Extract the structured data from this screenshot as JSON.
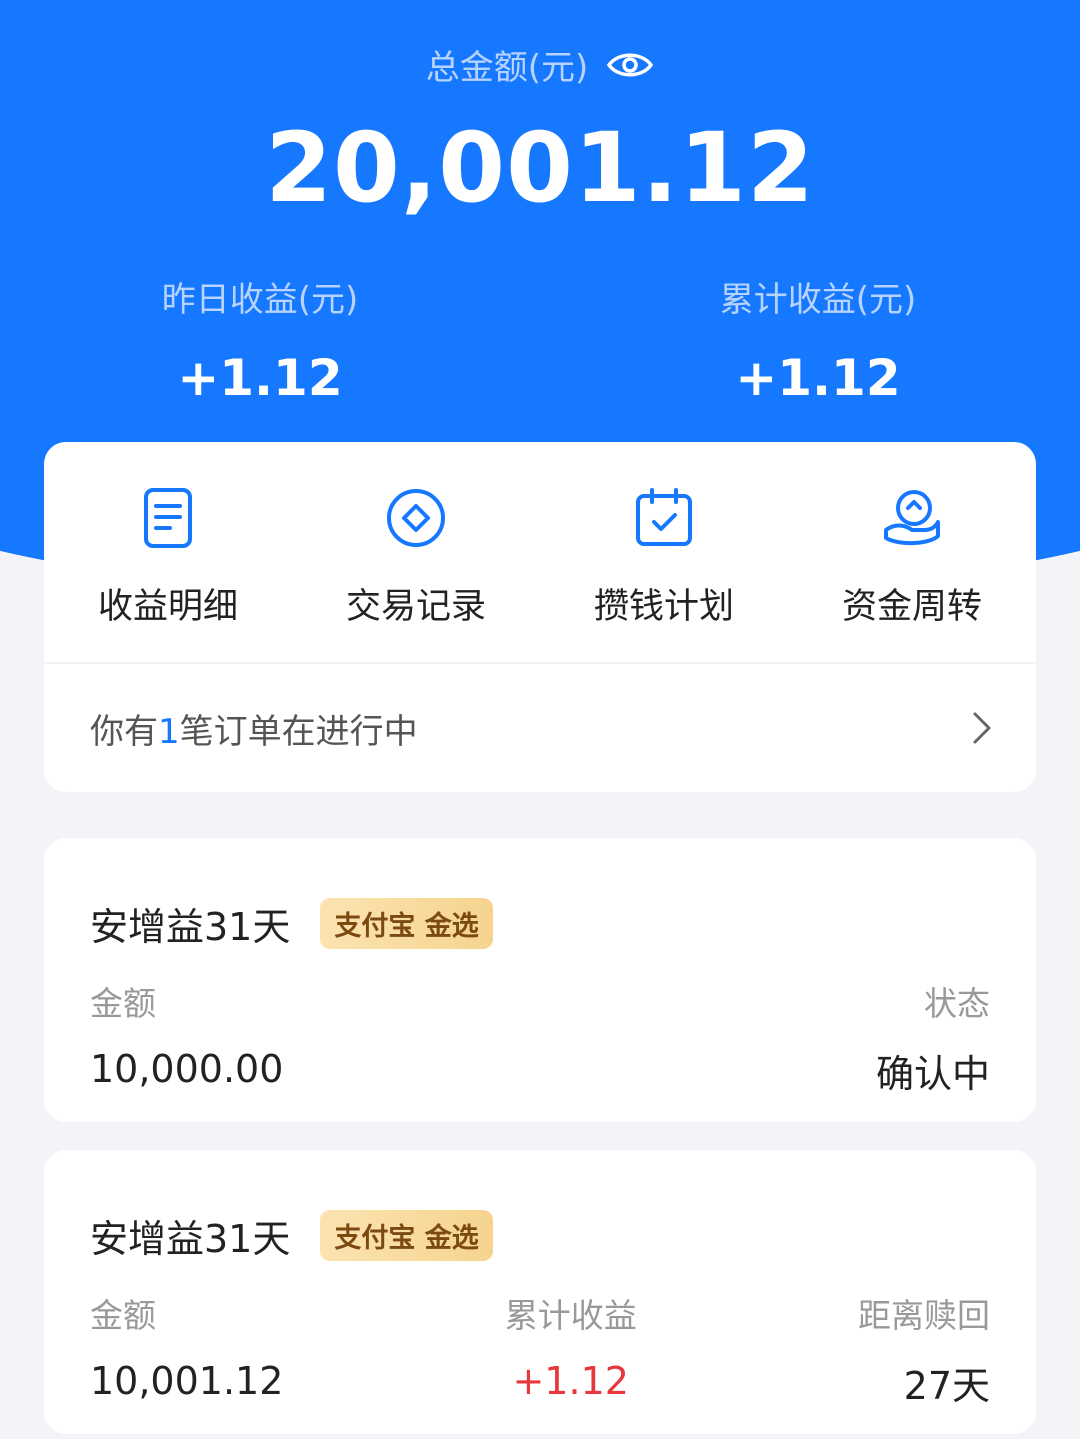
{
  "header": {
    "total_label": "总金额(元)",
    "total_amount": "20,001.12",
    "yesterday_label": "昨日收益(元)",
    "yesterday_value": "+1.12",
    "cumulative_label": "累计收益(元)",
    "cumulative_value": "+1.12"
  },
  "actions": [
    {
      "label": "收益明细",
      "icon": "document-icon"
    },
    {
      "label": "交易记录",
      "icon": "diamond-circle-icon"
    },
    {
      "label": "攒钱计划",
      "icon": "calendar-check-icon"
    },
    {
      "label": "资金周转",
      "icon": "hand-coin-icon"
    }
  ],
  "orders": {
    "prefix": "你有",
    "count": "1",
    "suffix": "笔订单在进行中"
  },
  "products": [
    {
      "title": "安增益31天",
      "badge": "支付宝 金选",
      "amount_label": "金额",
      "amount_value": "10,000.00",
      "status_label": "状态",
      "status_value": "确认中"
    },
    {
      "title": "安增益31天",
      "badge": "支付宝 金选",
      "amount_label": "金额",
      "amount_value": "10,001.12",
      "earnings_label": "累计收益",
      "earnings_value": "+1.12",
      "redeem_label": "距离赎回",
      "redeem_value": "27天"
    }
  ],
  "colors": {
    "brand_blue": "#1677ff",
    "positive_red": "#e8373b",
    "badge_gold": "#f6d48e"
  }
}
